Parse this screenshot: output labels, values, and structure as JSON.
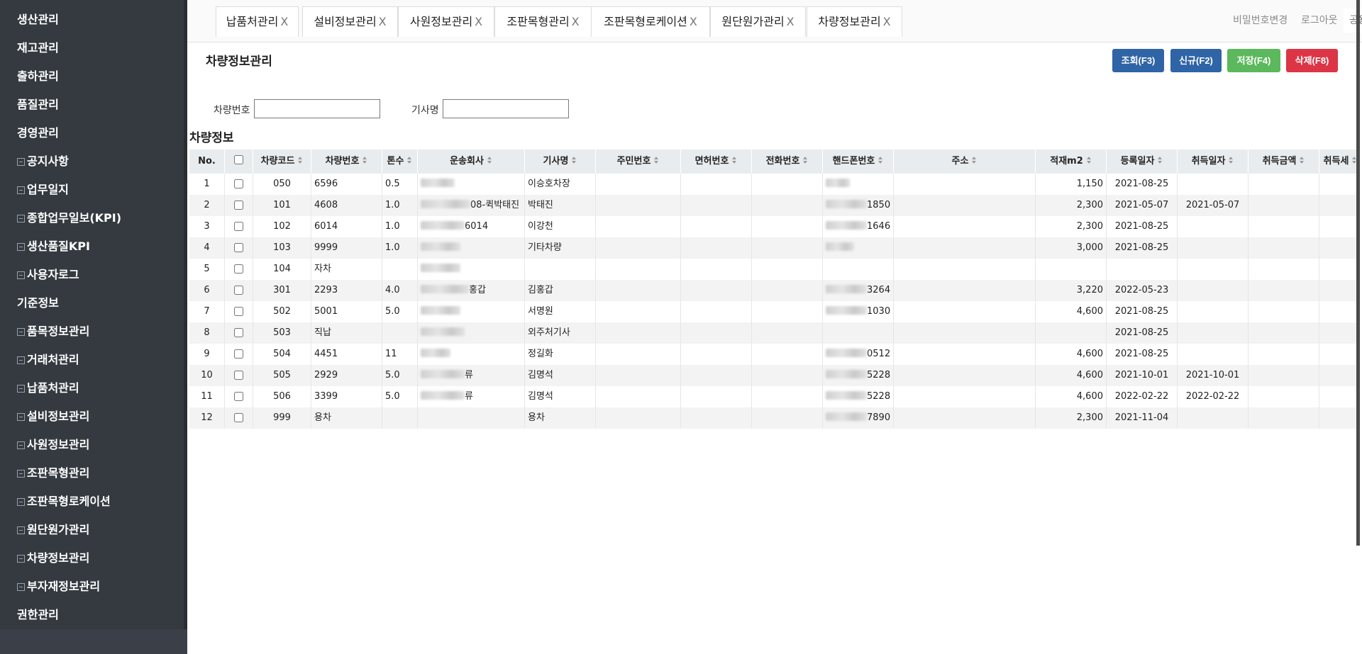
{
  "sidebar": {
    "items": [
      {
        "label": "생산관리",
        "type": "cat"
      },
      {
        "label": "재고관리",
        "type": "cat"
      },
      {
        "label": "출하관리",
        "type": "cat"
      },
      {
        "label": "품질관리",
        "type": "cat"
      },
      {
        "label": "경영관리",
        "type": "cat"
      },
      {
        "label": "공지사항",
        "type": "sub"
      },
      {
        "label": "업무일지",
        "type": "sub"
      },
      {
        "label": "종합업무일보(KPI)",
        "type": "sub"
      },
      {
        "label": "생산품질KPI",
        "type": "sub"
      },
      {
        "label": "사용자로그",
        "type": "sub"
      },
      {
        "label": "기준정보",
        "type": "cat"
      },
      {
        "label": "품목정보관리",
        "type": "sub"
      },
      {
        "label": "거래처관리",
        "type": "sub"
      },
      {
        "label": "납품처관리",
        "type": "sub"
      },
      {
        "label": "설비정보관리",
        "type": "sub"
      },
      {
        "label": "사원정보관리",
        "type": "sub"
      },
      {
        "label": "조판목형관리",
        "type": "sub"
      },
      {
        "label": "조판목형로케이션",
        "type": "sub"
      },
      {
        "label": "원단원가관리",
        "type": "sub"
      },
      {
        "label": "차량정보관리",
        "type": "sub"
      },
      {
        "label": "부자재정보관리",
        "type": "sub"
      },
      {
        "label": "권한관리",
        "type": "cat"
      }
    ]
  },
  "tabs": [
    {
      "label": "납품처관리",
      "close": "X"
    },
    {
      "label": "설비정보관리",
      "close": "X"
    },
    {
      "label": "사원정보관리",
      "close": "X"
    },
    {
      "label": "조판목형관리",
      "close": "X"
    },
    {
      "label": "조판목형로케이션",
      "close": "X"
    },
    {
      "label": "원단원가관리",
      "close": "X"
    },
    {
      "label": "차량정보관리",
      "close": "X"
    }
  ],
  "header": {
    "user_placeholder": "공용",
    "change_password": "비밀번호변경",
    "logout": "로그아웃"
  },
  "page": {
    "title": "차량정보관리",
    "buttons": {
      "search": "조회(F3)",
      "new": "신규(F2)",
      "save": "저장(F4)",
      "delete": "삭제(F8)"
    },
    "search": {
      "vehicle_no_label": "차량번호",
      "vehicle_no_value": "",
      "driver_label": "기사명",
      "driver_value": ""
    },
    "section_title": "차량정보"
  },
  "grid": {
    "columns": [
      "No.",
      "",
      "차량코드",
      "차량번호",
      "톤수",
      "운송회사",
      "기사명",
      "주민번호",
      "면허번호",
      "전화번호",
      "핸드폰번호",
      "주소",
      "적재m2",
      "등록일자",
      "취득일자",
      "취득금액",
      "취득세"
    ],
    "rows": [
      {
        "no": "1",
        "code": "050",
        "plate": "6596",
        "ton": "0.5",
        "company": "",
        "driver": "이승호차장",
        "phone": "",
        "area": "1,150",
        "reg": "2021-08-25",
        "acq": ""
      },
      {
        "no": "2",
        "code": "101",
        "plate": "4608",
        "ton": "1.0",
        "company": "08-퀵박태진",
        "driver": "박태진",
        "phone": "1850",
        "area": "2,300",
        "reg": "2021-05-07",
        "acq": "2021-05-07"
      },
      {
        "no": "3",
        "code": "102",
        "plate": "6014",
        "ton": "1.0",
        "company": "6014",
        "driver": "이강천",
        "phone": "1646",
        "area": "2,300",
        "reg": "2021-08-25",
        "acq": ""
      },
      {
        "no": "4",
        "code": "103",
        "plate": "9999",
        "ton": "1.0",
        "company": "",
        "driver": "기타차량",
        "phone": "",
        "area": "3,000",
        "reg": "2021-08-25",
        "acq": ""
      },
      {
        "no": "5",
        "code": "104",
        "plate": "자차",
        "ton": "",
        "company": "",
        "driver": "",
        "phone": "",
        "area": "",
        "reg": "",
        "acq": ""
      },
      {
        "no": "6",
        "code": "301",
        "plate": "2293",
        "ton": "4.0",
        "company": "홍갑",
        "driver": "김홍갑",
        "phone": "3264",
        "area": "3,220",
        "reg": "2022-05-23",
        "acq": ""
      },
      {
        "no": "7",
        "code": "502",
        "plate": "5001",
        "ton": "5.0",
        "company": "",
        "driver": "서명원",
        "phone": "1030",
        "area": "4,600",
        "reg": "2021-08-25",
        "acq": ""
      },
      {
        "no": "8",
        "code": "503",
        "plate": "직납",
        "ton": "",
        "company": "",
        "driver": "외주처기사",
        "phone": "",
        "area": "",
        "reg": "2021-08-25",
        "acq": ""
      },
      {
        "no": "9",
        "code": "504",
        "plate": "4451",
        "ton": "11",
        "company": "",
        "driver": "정길화",
        "phone": "0512",
        "area": "4,600",
        "reg": "2021-08-25",
        "acq": ""
      },
      {
        "no": "10",
        "code": "505",
        "plate": "2929",
        "ton": "5.0",
        "company": "류",
        "driver": "김명석",
        "phone": "5228",
        "area": "4,600",
        "reg": "2021-10-01",
        "acq": "2021-10-01"
      },
      {
        "no": "11",
        "code": "506",
        "plate": "3399",
        "ton": "5.0",
        "company": "류",
        "driver": "김명석",
        "phone": "5228",
        "area": "4,600",
        "reg": "2022-02-22",
        "acq": "2022-02-22"
      },
      {
        "no": "12",
        "code": "999",
        "plate": "용차",
        "ton": "",
        "company": "",
        "driver": "용차",
        "phone": "7890",
        "area": "2,300",
        "reg": "2021-11-04",
        "acq": ""
      }
    ]
  }
}
